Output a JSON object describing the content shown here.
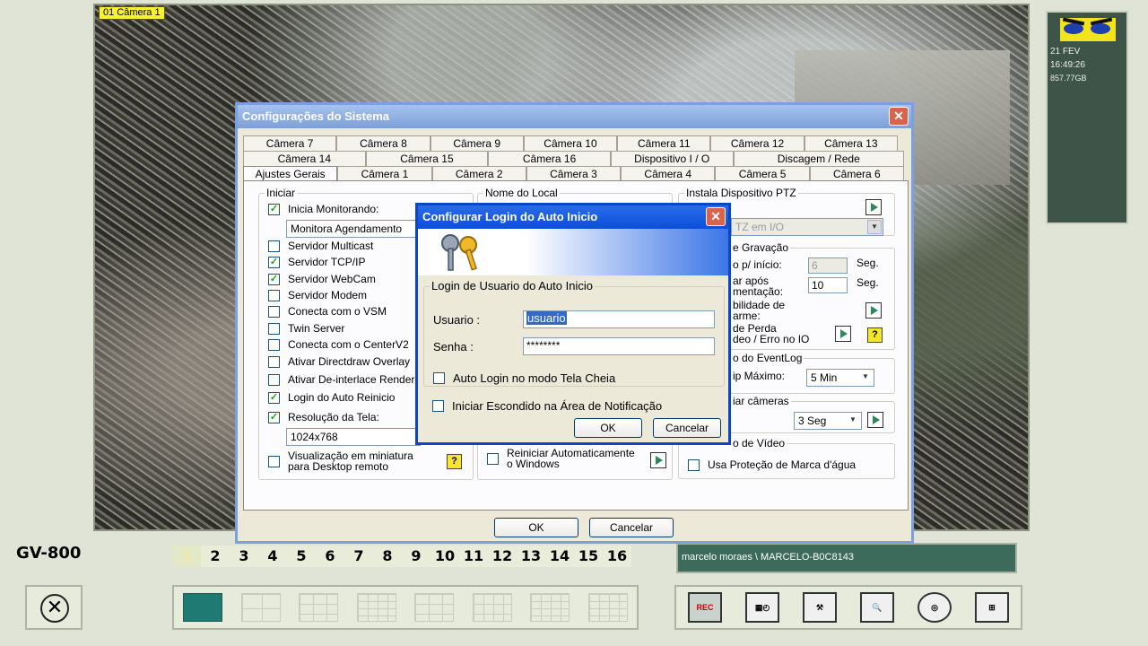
{
  "camera": {
    "label": "01 Câmera 1"
  },
  "status": {
    "date": "21 FEV",
    "time": "16:49:26",
    "disk": "857.77GB"
  },
  "app": {
    "name": "GV-800"
  },
  "channels": [
    "1",
    "2",
    "3",
    "4",
    "5",
    "6",
    "7",
    "8",
    "9",
    "10",
    "11",
    "12",
    "13",
    "14",
    "15",
    "16"
  ],
  "user": {
    "text": "marcelo moraes \\ MARCELO-B0C8143"
  },
  "sys": {
    "title": "Configurações do Sistema",
    "tabs_row1": [
      "Câmera 7",
      "Câmera 8",
      "Câmera 9",
      "Câmera 10",
      "Câmera 11",
      "Câmera 12",
      "Câmera 13"
    ],
    "tabs_row2": [
      "Câmera 14",
      "Câmera 15",
      "Câmera 16",
      "Dispositivo I / O",
      "Discagem / Rede"
    ],
    "tabs_row3": [
      "Ajustes Gerais",
      "Câmera 1",
      "Câmera 2",
      "Câmera 3",
      "Câmera 4",
      "Câmera 5",
      "Câmera 6"
    ],
    "iniciar": {
      "title": "Iniciar",
      "inicia": "Inicia Monitorando:",
      "monitor_combo": "Monitora Agendamento",
      "items": [
        "Servidor Multicast",
        "Servidor TCP/IP",
        "Servidor WebCam",
        "Servidor Modem",
        "Conecta com o VSM",
        "Twin Server",
        "Conecta com o CenterV2",
        "Ativar Directdraw Overlay",
        "Ativar De-interlace Render",
        "Login do Auto Reinicio",
        "Resolução da Tela:"
      ],
      "resolution": "1024x768",
      "miniatura_1": "Visualização em miniatura",
      "miniatura_2": "para Desktop remoto"
    },
    "nome_local": {
      "title": "Nome do Local"
    },
    "ptz": {
      "title": "Instala Dispositivo PTZ",
      "combo": "TZ em I/O"
    },
    "gravacao": {
      "title": "e Gravação",
      "l1": "o p/ início:",
      "v1": "6",
      "u1": "Seg.",
      "l2a": "ar após",
      "l2b": "mentação:",
      "v2": "10",
      "u2": "Seg.",
      "l3a": "bilidade de",
      "l3b": "arme:",
      "l4a": "de Perda",
      "l4b": "deo / Erro no IO"
    },
    "eventlog": {
      "title": "o do EventLog",
      "label": "ip Máximo:",
      "combo": "5 Min"
    },
    "cameras": {
      "title": "iar câmeras",
      "combo": "3 Seg"
    },
    "reiniciar": {
      "label1": "Reiniciar Automaticamente",
      "label2": "o Windows"
    },
    "video": {
      "title": "o de Vídeo",
      "label": "Usa Proteção de Marca d'água"
    },
    "ok": "OK",
    "cancel": "Cancelar"
  },
  "login": {
    "title": "Configurar Login do Auto Inicio",
    "group": "Login de Usuario do Auto Inicio",
    "user_label": "Usuario :",
    "user_value": "usuario",
    "pass_label": "Senha :",
    "pass_value": "********",
    "auto_login": "Auto Login no modo Tela Cheia",
    "hidden": "Iniciar Escondido na Área de Notificação",
    "ok": "OK",
    "cancel": "Cancelar"
  },
  "icons": {
    "exit": "exit-icon",
    "rec": "REC",
    "tools": [
      "rec-icon",
      "schedule-icon",
      "tools-icon",
      "search-icon",
      "network-icon",
      "hierarchy-icon"
    ]
  }
}
